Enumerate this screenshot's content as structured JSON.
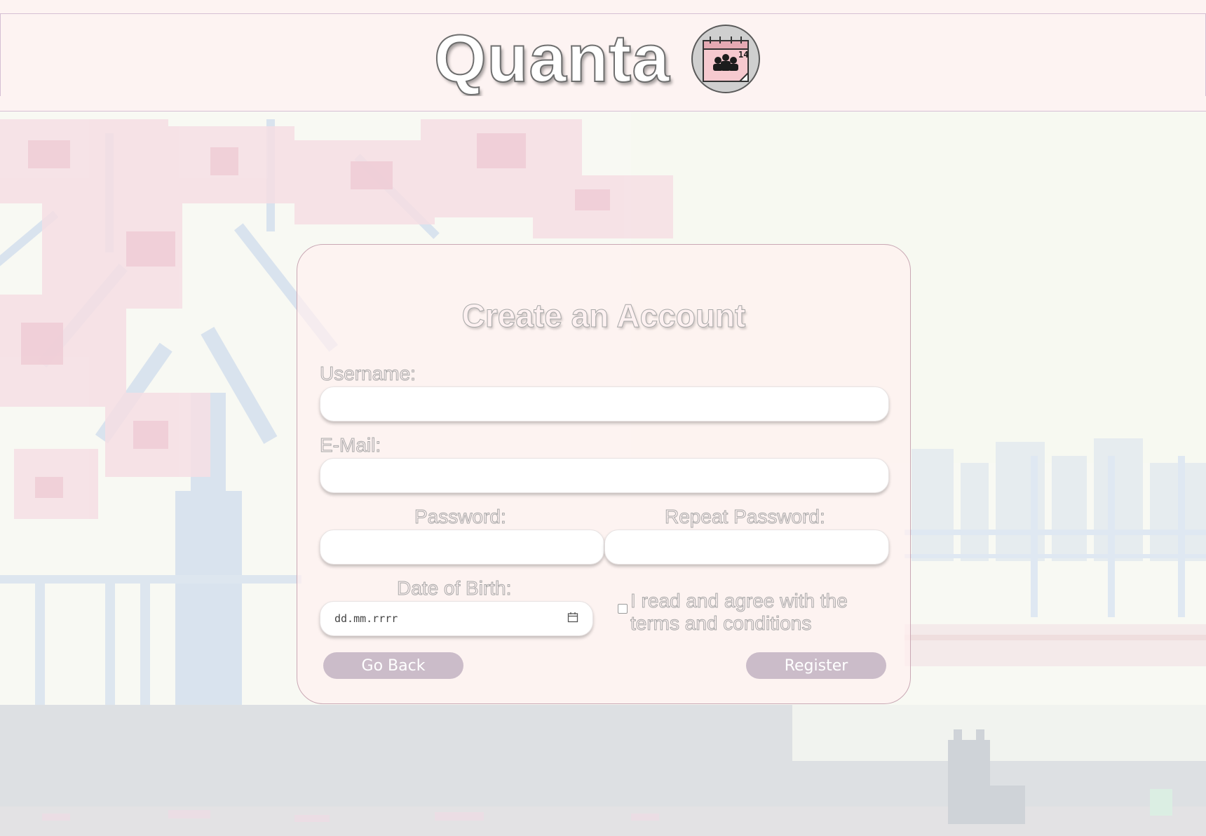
{
  "header": {
    "app_title": "Quanta",
    "logo_icon": "calendar-group-icon",
    "logo_day": "14"
  },
  "form": {
    "title": "Create an Account",
    "username_label": "Username:",
    "username_value": "",
    "email_label": "E-Mail:",
    "email_value": "",
    "password_label": "Password:",
    "password_value": "",
    "repeat_password_label": "Repeat Password:",
    "repeat_password_value": "",
    "dob_label": "Date of Birth:",
    "dob_placeholder": "dd.mm.rrrr",
    "terms_label": "I read and agree with the terms and conditions",
    "terms_checked": false,
    "go_back_label": "Go Back",
    "register_label": "Register"
  },
  "colors": {
    "header_bg": "#fdf3f2",
    "header_border": "#d5bfd4",
    "card_bg": "#fff0f0",
    "button_bg": "#cbbcc9",
    "blossom": "#f3cfd8",
    "branch": "#c9d6e4"
  }
}
